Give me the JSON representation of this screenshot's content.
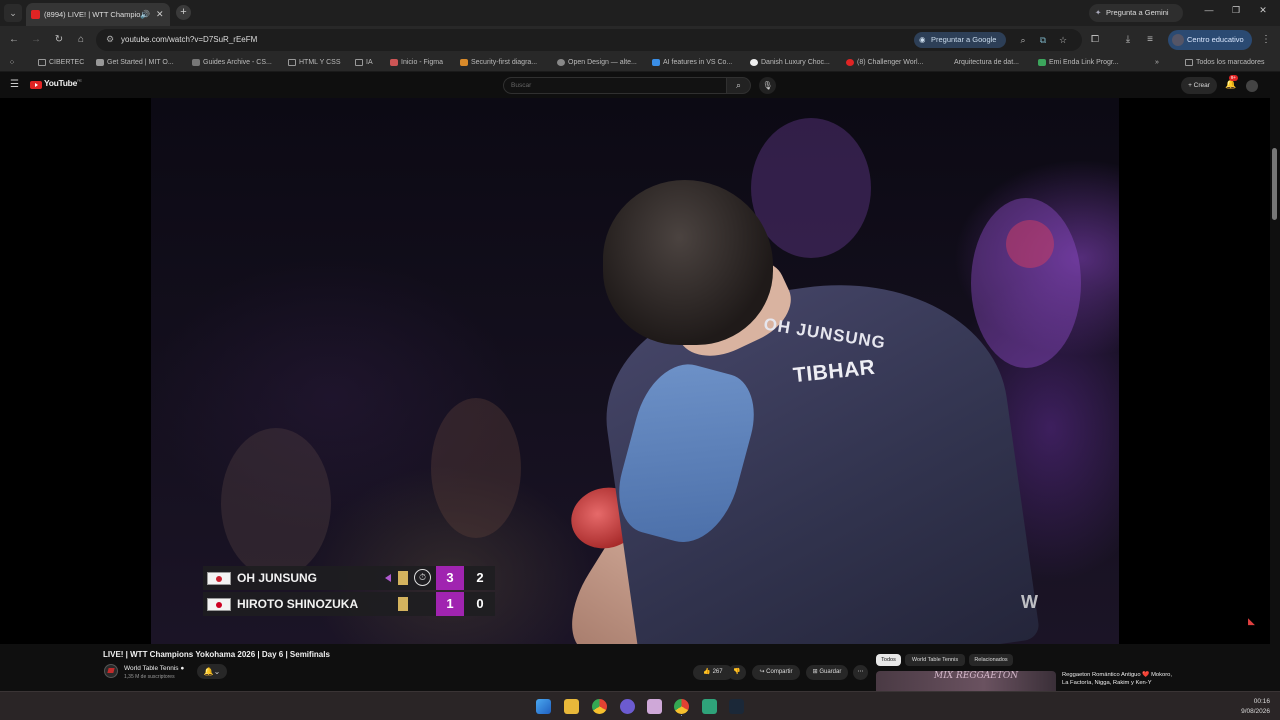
{
  "browser": {
    "tab_menu_icon": "chevron-down-icon",
    "active_tab_title": "(8994) LIVE! | WTT Champio",
    "gemini_button": "Pregunta a Gemini",
    "url": "youtube.com/watch?v=D7SuR_rEeFM",
    "ask_google": "Preguntar a Google",
    "profile_label": "Centro educativo"
  },
  "bookmarks": {
    "items": [
      "CIBERTEC",
      "Get Started | MIT O...",
      "Guides Archive - CS...",
      "HTML Y CSS",
      "IA",
      "Inicio - Figma",
      "Security-first diagra...",
      "Open Design — alte...",
      "AI features in VS Co...",
      "Danish Luxury Choc...",
      "(8) Challenger Worl...",
      "Arquitectura de dat...",
      "Emi Enda Link Progr..."
    ],
    "all_bookmarks": "Todos los marcadores"
  },
  "youtube": {
    "logo_text": "YouTube",
    "logo_super": "PE",
    "search_placeholder": "Buscar",
    "create_label": "Crear",
    "notif_badge": "9+"
  },
  "scoreboard": {
    "players": [
      {
        "name": "OH JUNSUNG",
        "games": "3",
        "points": "2",
        "country_color": "#c8202f"
      },
      {
        "name": "HIROTO SHINOZUKA",
        "games": "1",
        "points": "0",
        "country_color": "#cc0022"
      }
    ],
    "games_color": "#a024b0",
    "card_color": "#d4b35e"
  },
  "video_overlay": {
    "jersey_name": "OH JUNSUNG",
    "jersey_brand": "TIBHAR"
  },
  "below_video": {
    "title": "LIVE! | WTT Champions Yokohama 2026 | Day 6 | Semifinals",
    "channel_name": "World Table Tennis ●",
    "channel_subs": "1,35 M de suscriptores",
    "likes": "267",
    "share": "Compartir",
    "save": "Guardar",
    "chips": [
      "Todos",
      "World Table Tennis",
      "Relacionados"
    ],
    "thumb_text": "MIX REGGAETON",
    "rec_title": "Reggaeton Romántico Antiguo ❤️ Mokoro, La Factoría, Nigga, Rakim y Ken-Y"
  },
  "taskbar": {
    "time": "00:16",
    "date": "9/08/2026"
  }
}
